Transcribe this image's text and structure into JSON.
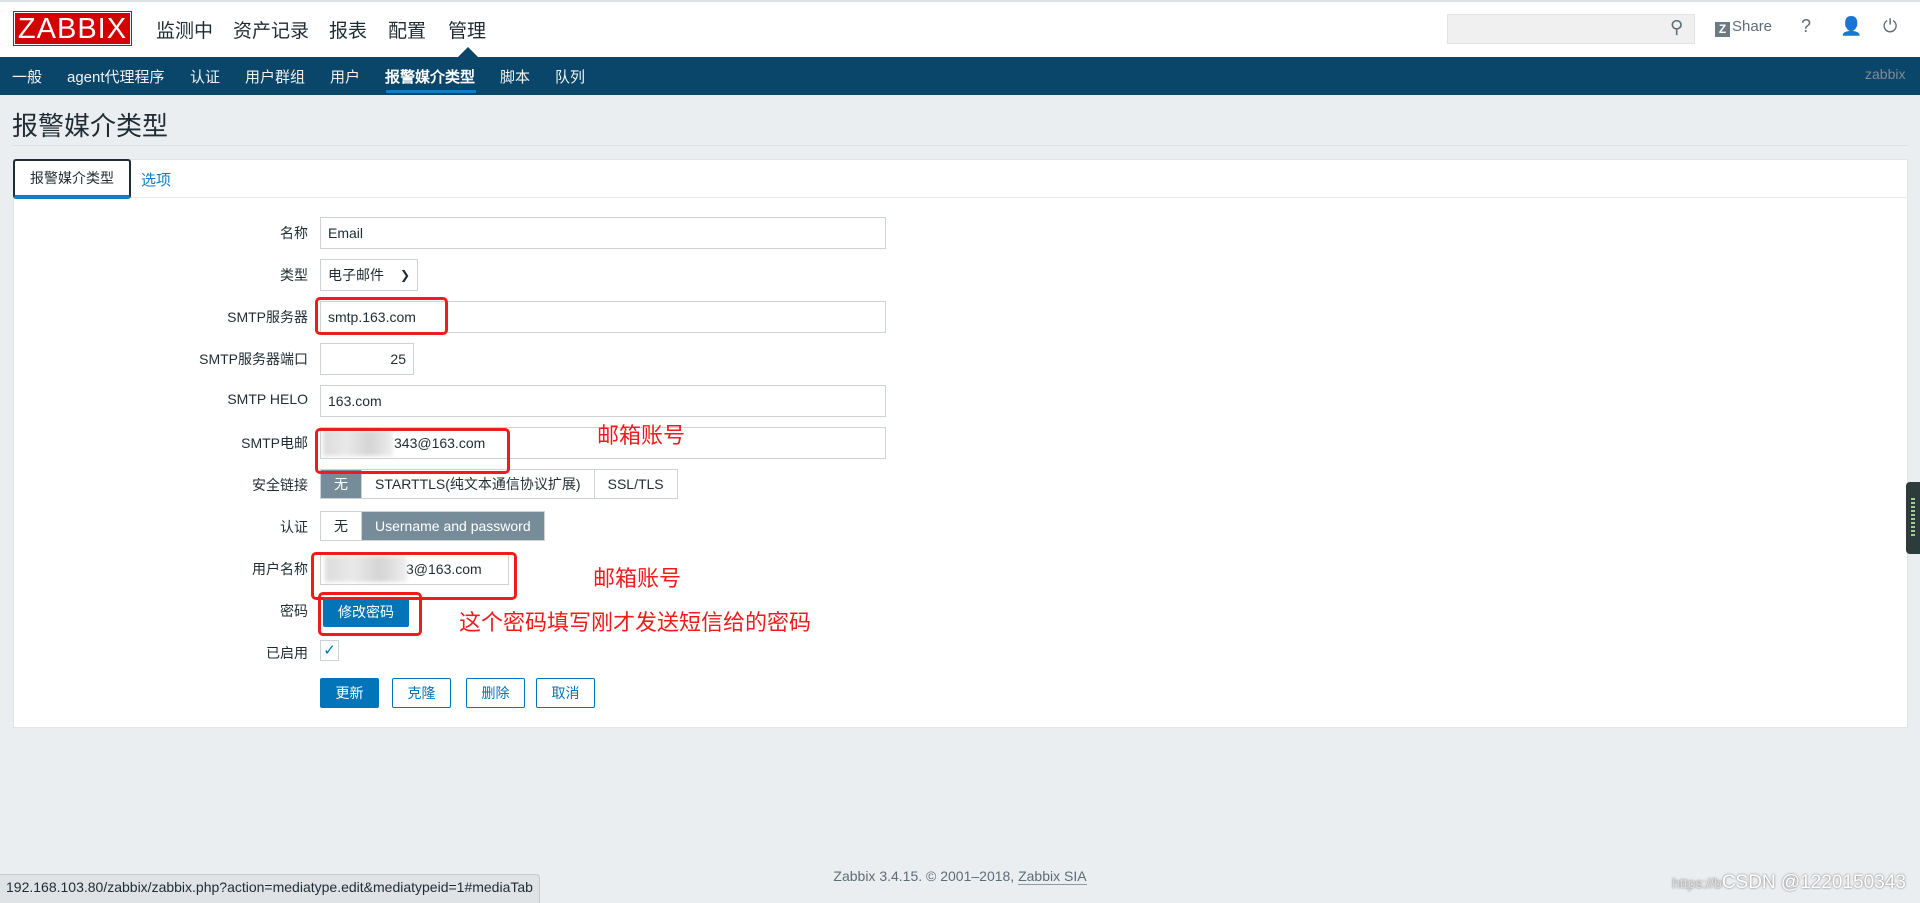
{
  "header": {
    "logo": "ZABBIX",
    "menu": [
      "监测中",
      "资产记录",
      "报表",
      "配置",
      "管理"
    ],
    "active_menu": "管理",
    "search_placeholder": "",
    "share": "Share",
    "help": "?"
  },
  "subnav": {
    "items": [
      "一般",
      "agent代理程序",
      "认证",
      "用户群组",
      "用户",
      "报警媒介类型",
      "脚本",
      "队列"
    ],
    "active": "报警媒介类型",
    "user": "zabbix"
  },
  "page": {
    "title": "报警媒介类型"
  },
  "tabs": [
    "报警媒介类型",
    "选项"
  ],
  "form": {
    "name": {
      "label": "名称",
      "value": "Email"
    },
    "type": {
      "label": "类型",
      "value": "电子邮件"
    },
    "smtp_server": {
      "label": "SMTP服务器",
      "value": "smtp.163.com"
    },
    "smtp_port": {
      "label": "SMTP服务器端口",
      "value": "25"
    },
    "smtp_helo": {
      "label": "SMTP HELO",
      "value": "163.com"
    },
    "smtp_email": {
      "label": "SMTP电邮",
      "value": "343@163.com"
    },
    "security": {
      "label": "安全链接",
      "options": [
        "无",
        "STARTTLS(纯文本通信协议扩展)",
        "SSL/TLS"
      ],
      "selected": "无"
    },
    "auth": {
      "label": "认证",
      "options": [
        "无",
        "Username and password"
      ],
      "selected": "Username and password"
    },
    "username": {
      "label": "用户名称",
      "value": "3@163.com"
    },
    "password": {
      "label": "密码",
      "button": "修改密码"
    },
    "enabled": {
      "label": "已启用",
      "checked": true
    },
    "buttons": {
      "update": "更新",
      "clone": "克隆",
      "delete": "删除",
      "cancel": "取消"
    }
  },
  "annotations": {
    "email_note": "邮箱账号",
    "username_note": "邮箱账号",
    "password_note": "这个密码填写刚才发送短信给的密码",
    "color": "#f01c1c"
  },
  "footer": {
    "text": "Zabbix 3.4.15. © 2001–2018, ",
    "link": "Zabbix SIA"
  },
  "statusbar": {
    "url": "192.168.103.80/zabbix/zabbix.php?action=mediatype.edit&mediatypeid=1#mediaTab"
  },
  "watermark": {
    "prefix": "https://b",
    "text": "CSDN @1220150343"
  }
}
